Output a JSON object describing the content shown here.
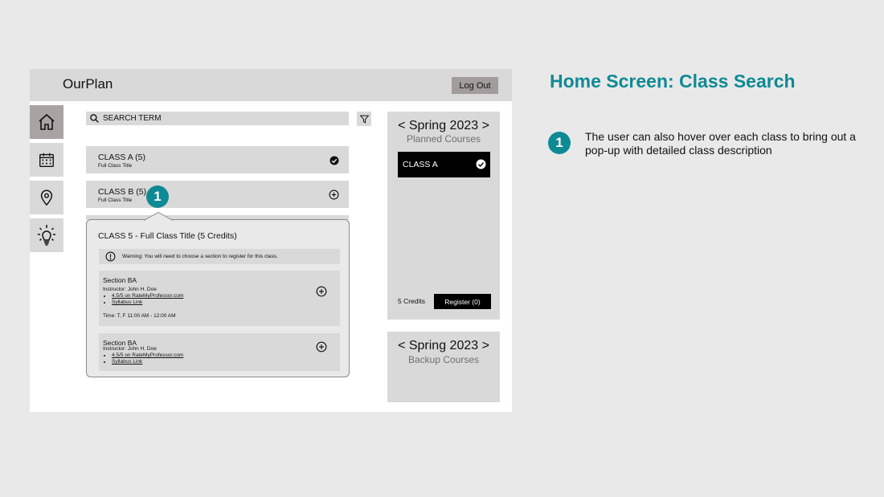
{
  "app": {
    "name": "OurPlan",
    "logout_label": "Log Out"
  },
  "sidebar": {
    "items": [
      {
        "name": "home-icon",
        "active": true
      },
      {
        "name": "calendar-icon",
        "active": false
      },
      {
        "name": "location-pin-icon",
        "active": false
      },
      {
        "name": "lightbulb-icon",
        "active": false
      }
    ]
  },
  "search": {
    "placeholder": "SEARCH TERM",
    "value": ""
  },
  "classes": [
    {
      "name": "CLASS A (5)",
      "title": "Full Class Title",
      "status": "added"
    },
    {
      "name": "CLASS B (5)",
      "title": "Full Class Title",
      "status": "not-added"
    }
  ],
  "popup": {
    "title": "CLASS 5 - Full Class Title (5 Credits)",
    "warning": "Warning: You will need to choose a section to register for this class.",
    "sections": [
      {
        "name": "Section BA",
        "instructor": "Instructor: John H. Doe",
        "rating_link": "4.5/5 on RateMyProfessor.com",
        "syllabus_link": "Syllabus Link",
        "time": "Time: T, F 11:00 AM - 12:00 AM"
      },
      {
        "name": "Section BA",
        "instructor": "Instructor: John H. Doe",
        "rating_link": "4.5/5 on RateMyProfessor.com",
        "syllabus_link": "Syllabus Link"
      }
    ]
  },
  "planner": {
    "planned": {
      "term": "< Spring 2023 >",
      "label": "Planned Courses",
      "classes": [
        "CLASS A"
      ],
      "credits": "5 Credits",
      "register_label": "Register (0)"
    },
    "backup": {
      "term": "< Spring 2023 >",
      "label": "Backup Courses"
    }
  },
  "annotation": {
    "heading": "Home Screen: Class Search",
    "step_number": "1",
    "description": "The user can also hover over each class to bring out a pop-up with detailed class description"
  },
  "colors": {
    "accent": "#0e8a95",
    "panel": "#d9d9d9",
    "active_nav": "#aaa3a3",
    "logout": "#a29c9c"
  }
}
